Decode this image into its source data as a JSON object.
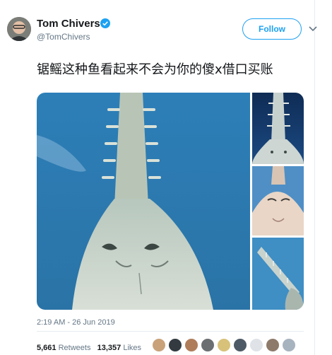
{
  "author": {
    "name": "Tom Chivers",
    "handle": "@TomChivers",
    "verified": true
  },
  "follow_button": {
    "label": "Follow"
  },
  "tweet": {
    "text": "锯鳐这种鱼看起来不会为你的傻x借口买账",
    "timestamp": "2:19 AM - 26 Jun 2019"
  },
  "stats": {
    "retweets_count": "5,661",
    "retweets_label": "Retweets",
    "likes_count": "13,357",
    "likes_label": "Likes"
  },
  "icons": {
    "verified": "verified-badge-icon",
    "menu": "chevron-down-icon"
  },
  "colors": {
    "accent": "#1da1f2",
    "muted": "#657786",
    "text": "#14171a",
    "divider": "#e6ecf0"
  }
}
